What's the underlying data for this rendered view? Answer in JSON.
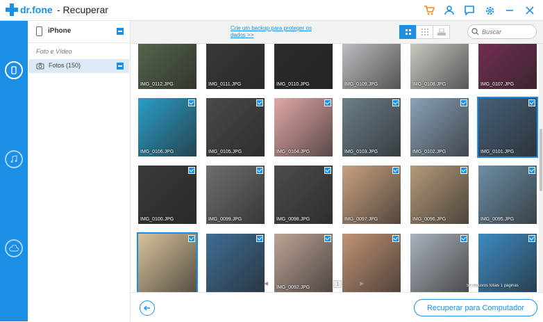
{
  "app": {
    "logo": "dr.fone",
    "title": "- Recuperar"
  },
  "titlebar": {
    "icons": [
      "cart-icon",
      "user-icon",
      "feedback-icon",
      "settings-icon",
      "minimize-icon",
      "close-icon"
    ]
  },
  "rail": {
    "items": [
      "phone-recover-icon",
      "music-icon",
      "cloud-icon"
    ]
  },
  "tree": {
    "device": "iPhone",
    "category": "Foto e Vídeo",
    "items": [
      {
        "label": "Fotos (150)"
      }
    ]
  },
  "topbar": {
    "backup_link": "Crie um backup para proteger os dados >>",
    "search_placeholder": "Buscar"
  },
  "photos": [
    {
      "name": "IMG_0112.JPG",
      "color": "#5a6a4e",
      "checked": false
    },
    {
      "name": "IMG_0111.JPG",
      "color": "#3a3a3a",
      "checked": false
    },
    {
      "name": "IMG_0110.JPG",
      "color": "#2c2c2c",
      "checked": false
    },
    {
      "name": "IMG_0109.JPG",
      "color": "#c8ccd0",
      "checked": false
    },
    {
      "name": "IMG_0108.JPG",
      "color": "#d9d6cf",
      "checked": false
    },
    {
      "name": "IMG_0107.JPG",
      "color": "#7a2e55",
      "checked": false
    },
    {
      "name": "IMG_0106.JPG",
      "color": "#2a9dc6",
      "checked": true
    },
    {
      "name": "IMG_0105.JPG",
      "color": "#4a4a4a",
      "checked": true
    },
    {
      "name": "IMG_0104.JPG",
      "color": "#e2a8a6",
      "checked": true
    },
    {
      "name": "IMG_0103.JPG",
      "color": "#6b7f8a",
      "checked": true
    },
    {
      "name": "IMG_0102.JPG",
      "color": "#8aa2b8",
      "checked": true
    },
    {
      "name": "IMG_0101.JPG",
      "color": "#47607a",
      "checked": true,
      "selected": true
    },
    {
      "name": "IMG_0100.JPG",
      "color": "#3a3a3a",
      "checked": true
    },
    {
      "name": "IMG_0099.JPG",
      "color": "#6e6e6e",
      "checked": true
    },
    {
      "name": "IMG_0098.JPG",
      "color": "#4c4c4c",
      "checked": true
    },
    {
      "name": "IMG_0097.JPG",
      "color": "#c9a180",
      "checked": true
    },
    {
      "name": "IMG_0096.JPG",
      "color": "#b59a7a",
      "checked": true
    },
    {
      "name": "IMG_0095.JPG",
      "color": "#6d8ea6",
      "checked": true
    },
    {
      "name": "",
      "color": "#d8c29a",
      "checked": true,
      "selected": true
    },
    {
      "name": "",
      "color": "#3f6d95",
      "checked": true
    },
    {
      "name": "IMG_0092.JPG",
      "color": "#bda394",
      "checked": true
    },
    {
      "name": "",
      "color": "#c29375",
      "checked": true
    },
    {
      "name": "",
      "color": "#aab2bb",
      "checked": true
    },
    {
      "name": "",
      "color": "#3c8bc2",
      "checked": true
    }
  ],
  "pager": {
    "page": "1",
    "summary": "50 arquivos totais 1 páginas"
  },
  "bottom": {
    "recover_label": "Recuperar para Computador"
  }
}
